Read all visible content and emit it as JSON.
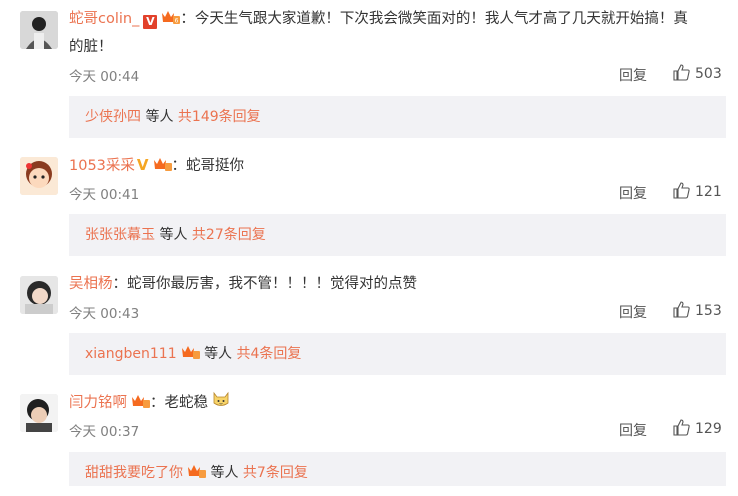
{
  "comments": [
    {
      "user": "蛇哥colin_",
      "text": "：今天生气跟大家道歉！下次我会微笑面对的！我人气才高了几天就开始搞！真",
      "text2": "的脏！",
      "time": "今天 00:44",
      "reply": "回复",
      "likes": "503",
      "sub_user": "少侠孙四",
      "sub_mid": "等人",
      "sub_count": "共149条回复"
    },
    {
      "user": "1053采采",
      "text": "：蛇哥挺你",
      "time": "今天 00:41",
      "reply": "回复",
      "likes": "121",
      "sub_user": "张张张幕玉",
      "sub_mid": "等人",
      "sub_count": "共27条回复"
    },
    {
      "user": "吴相杨",
      "text": "：蛇哥你最厉害，我不管！！！！觉得对的点赞",
      "time": "今天 00:43",
      "reply": "回复",
      "likes": "153",
      "sub_user": "xiangben111",
      "sub_mid": "等人",
      "sub_count": "共4条回复"
    },
    {
      "user": "闫力铭啊",
      "text": "：老蛇稳",
      "time": "今天 00:37",
      "reply": "回复",
      "likes": "129",
      "sub_user": "甜甜我要吃了你",
      "sub_mid": "等人",
      "sub_count": "共7条回复"
    }
  ],
  "colors": {
    "username": "#eb7350",
    "muted": "#808080",
    "sub_bg": "#f2f2f5",
    "verified_red": "#e2412b",
    "verified_yellow": "#f5a623"
  },
  "icons": [
    "verified-v-icon",
    "member-crown-icon",
    "thumbs-up-icon",
    "cat-emoji-icon"
  ]
}
